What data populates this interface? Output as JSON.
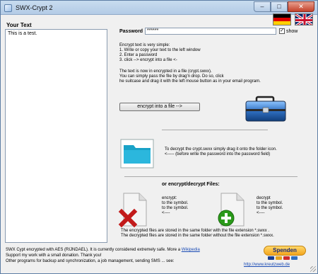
{
  "window": {
    "title": "SWX-Crypt 2",
    "min": "–",
    "max": "□",
    "close": "✕"
  },
  "icons": {
    "app": "app-icon",
    "flag_de": "flag-de-icon",
    "flag_uk": "flag-uk-icon",
    "suitcase": "suitcase-icon",
    "folder": "folder-icon",
    "encrypt_file": "file-encrypt-icon",
    "decrypt_file": "file-decrypt-icon"
  },
  "left": {
    "label": "Your Text",
    "text": "This is a test."
  },
  "password": {
    "label": "Password",
    "value": "******",
    "show_label": "show",
    "show_checked": true
  },
  "instructions": {
    "intro": "Encrypt text is very simple:",
    "step1": "1. Write or copy your text to the left window",
    "step2": "2. Enter a password",
    "step3": "3. click --> encrypt into a file <-",
    "after1": "The text is now in encrypted in a file (crypt.swxx).",
    "after2": "You can simply pass the file by drag'n drop. Do so, click",
    "after3": "he suitcase and drag it with the left mouse button as in your email program."
  },
  "encrypt_button": "encrypt into a file -->",
  "decrypt": {
    "line1": "To decrypt the crypt.swxx simply drag it onto the folder icon.",
    "line2": "<----- (before write the password into the password field)"
  },
  "files": {
    "heading": "or encrypt/decrypt Files:",
    "encrypt_col": [
      "encrypt:",
      "to the symbol.",
      "to the symbol.",
      "<----"
    ],
    "decrypt_col": [
      "decrypt",
      "to the symbol.",
      "to the symbol.",
      "<----"
    ],
    "ext1": "The encrypted files are stored in the same folder with the file extension *.swxx .",
    "ext2": "The decrypted files are stored in the same folder without the file extension *.swxx."
  },
  "footer": {
    "line1": "SWX Cypt encrypted with AES (RIJNDAEL). It is currently considered extremely safe. More a",
    "wiki": "Wikipedia",
    "line2": "Support my work with a small donation. Thank you!",
    "line3": "Other programs for backup and synchronization, a job management, sending SMS ... see:",
    "donate": "Spenden",
    "site": "http://www.kreutzweb.de"
  },
  "colors": {
    "accent_blue": "#1a4bb5",
    "donate_gold": "#f4a51d",
    "red_x": "#c21a1a",
    "green_plus": "#2a9a1a"
  }
}
